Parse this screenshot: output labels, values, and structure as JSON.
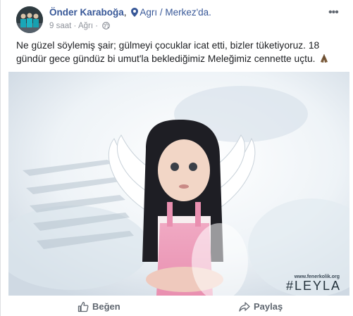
{
  "post": {
    "author_name": "Önder Karaboğa",
    "separator": ",",
    "location": "Agrı / Merkez'da.",
    "time": "9 saat",
    "audience": "Ağrı",
    "more_label": "•••",
    "text": "Ne güzel söylemiş şair; gülmeyi çocuklar icat etti, bizler tüketiyoruz. 18 gündür gece gündüz bi umut'la beklediğimiz Meleğimiz cennette uçtu.",
    "image": {
      "watermark_url": "www.fenerkolik.org",
      "watermark_tag": "#LEYLA"
    }
  },
  "actions": {
    "like_label": "Beğen",
    "share_label": "Paylaş"
  },
  "colors": {
    "link": "#385898",
    "meta": "#90949c",
    "action": "#606770"
  },
  "icons": [
    "map-pin-icon",
    "globe-icon",
    "praying-hands-icon",
    "thumbs-up-icon",
    "share-arrow-icon",
    "more-options-icon"
  ]
}
